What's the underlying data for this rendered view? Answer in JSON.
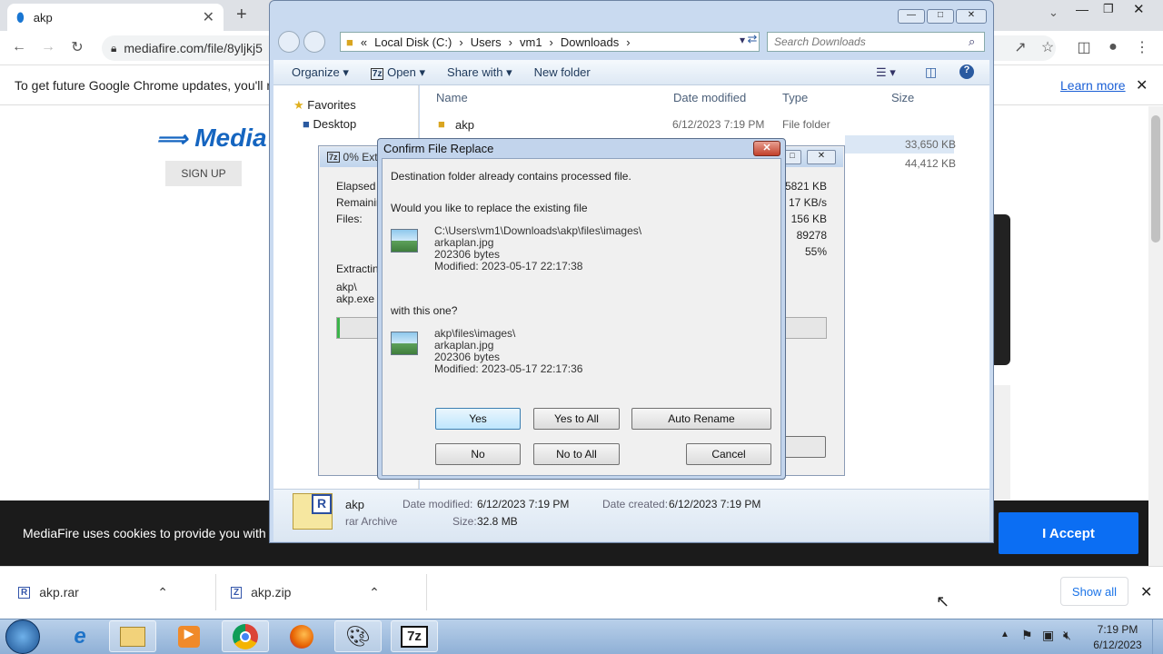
{
  "browser": {
    "tab_title": "akp",
    "url": "mediafire.com/file/8yljkj5",
    "infobar_text": "To get future Google Chrome updates, you'll nee",
    "learn_more": "Learn more"
  },
  "mediafire": {
    "logo": "Media",
    "signup": "SIGN UP",
    "cookie_text": "MediaFire uses cookies to provide you with a p",
    "accept": "I Accept"
  },
  "downloads_bar": {
    "items": [
      {
        "name": "akp.rar"
      },
      {
        "name": "akp.zip"
      }
    ],
    "show_all": "Show all"
  },
  "explorer": {
    "breadcrumb": [
      "«",
      "Local Disk (C:)",
      "Users",
      "vm1",
      "Downloads"
    ],
    "search_placeholder": "Search Downloads",
    "commands": [
      "Organize",
      "Open",
      "Share with",
      "New folder"
    ],
    "nav": {
      "favorites": "Favorites",
      "desktop": "Desktop"
    },
    "columns": [
      "Name",
      "Date modified",
      "Type",
      "Size"
    ],
    "rows": [
      {
        "name": "akp",
        "date": "6/12/2023 7:19 PM",
        "type": "File folder",
        "size": ""
      },
      {
        "name": "",
        "date": "",
        "type": "",
        "size": "33,650 KB"
      },
      {
        "name": "",
        "date": "",
        "type": "",
        "size": "44,412 KB"
      }
    ],
    "details": {
      "name": "akp",
      "kind": "rar Archive",
      "date_modified_label": "Date modified:",
      "date_modified": "6/12/2023 7:19 PM",
      "date_created_label": "Date created:",
      "date_created": "6/12/2023 7:19 PM",
      "size_label": "Size:",
      "size": "32.8 MB"
    }
  },
  "zip_progress": {
    "title": "0% Ext",
    "labels": [
      "Elapsed t",
      "Remainin",
      "Files:"
    ],
    "values": [
      "45821 KB",
      "17 KB/s",
      "156 KB",
      "89278",
      "55%"
    ],
    "extracting_label": "Extracting",
    "paths": [
      "akp\\",
      "akp.exe"
    ]
  },
  "dialog": {
    "title": "Confirm File Replace",
    "line1": "Destination folder already contains processed file.",
    "line2": "Would you like to replace the existing file",
    "existing": {
      "path": "C:\\Users\\vm1\\Downloads\\akp\\files\\images\\",
      "name": "arkaplan.jpg",
      "size": "202306 bytes",
      "modified": "Modified: 2023-05-17 22:17:38"
    },
    "with_this": "with this one?",
    "incoming": {
      "path": "akp\\files\\images\\",
      "name": "arkaplan.jpg",
      "size": "202306 bytes",
      "modified": "Modified: 2023-05-17 22:17:36"
    },
    "buttons": {
      "yes": "Yes",
      "yes_all": "Yes to All",
      "auto_rename": "Auto Rename",
      "no": "No",
      "no_all": "No to All",
      "cancel": "Cancel"
    }
  },
  "taskbar": {
    "time": "7:19 PM",
    "date": "6/12/2023"
  }
}
